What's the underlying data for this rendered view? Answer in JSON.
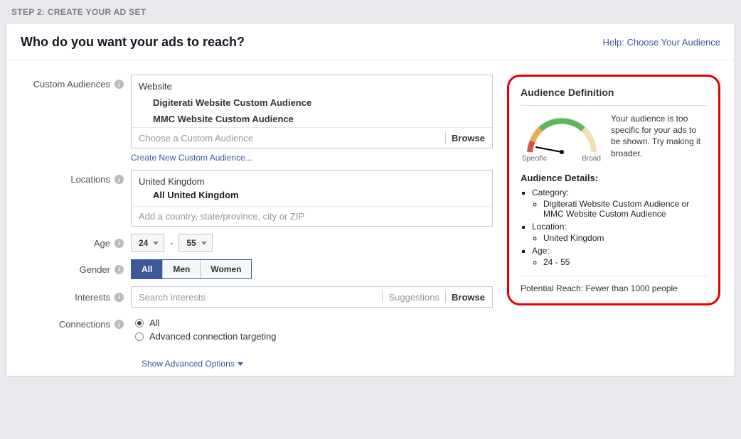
{
  "step_header": "STEP 2: CREATE YOUR AD SET",
  "panel": {
    "title": "Who do you want your ads to reach?",
    "help_link": "Help: Choose Your Audience"
  },
  "labels": {
    "custom_audiences": "Custom Audiences",
    "locations": "Locations",
    "age": "Age",
    "gender": "Gender",
    "interests": "Interests",
    "connections": "Connections"
  },
  "custom_audiences": {
    "group_header": "Website",
    "items": [
      "Digiterati Website Custom Audience",
      "MMC Website Custom Audience"
    ],
    "placeholder": "Choose a Custom Audience",
    "browse": "Browse",
    "create_link": "Create New Custom Audience..."
  },
  "locations": {
    "country": "United Kingdom",
    "sub": "All United Kingdom",
    "placeholder": "Add a country, state/province, city or ZIP"
  },
  "age": {
    "min": "24",
    "max": "55",
    "dash": "-"
  },
  "gender": {
    "options": [
      "All",
      "Men",
      "Women"
    ],
    "active_index": 0
  },
  "interests": {
    "placeholder": "Search interests",
    "suggestions": "Suggestions",
    "browse": "Browse"
  },
  "connections": {
    "options": [
      "All",
      "Advanced connection targeting"
    ],
    "selected_index": 0
  },
  "advanced_link": "Show Advanced Options",
  "audience": {
    "title": "Audience Definition",
    "meter": {
      "left": "Specific",
      "right": "Broad"
    },
    "message": "Your audience is too specific for your ads to be shown. Try making it broader.",
    "details_title": "Audience Details:",
    "cat_label": "Category:",
    "cat_value": "Digiterati Website Custom Audience or MMC Website Custom Audience",
    "loc_label": "Location:",
    "loc_value": "United Kingdom",
    "age_label": "Age:",
    "age_value": "24 - 55",
    "reach_label": "Potential Reach:",
    "reach_value": "Fewer than 1000 people"
  }
}
